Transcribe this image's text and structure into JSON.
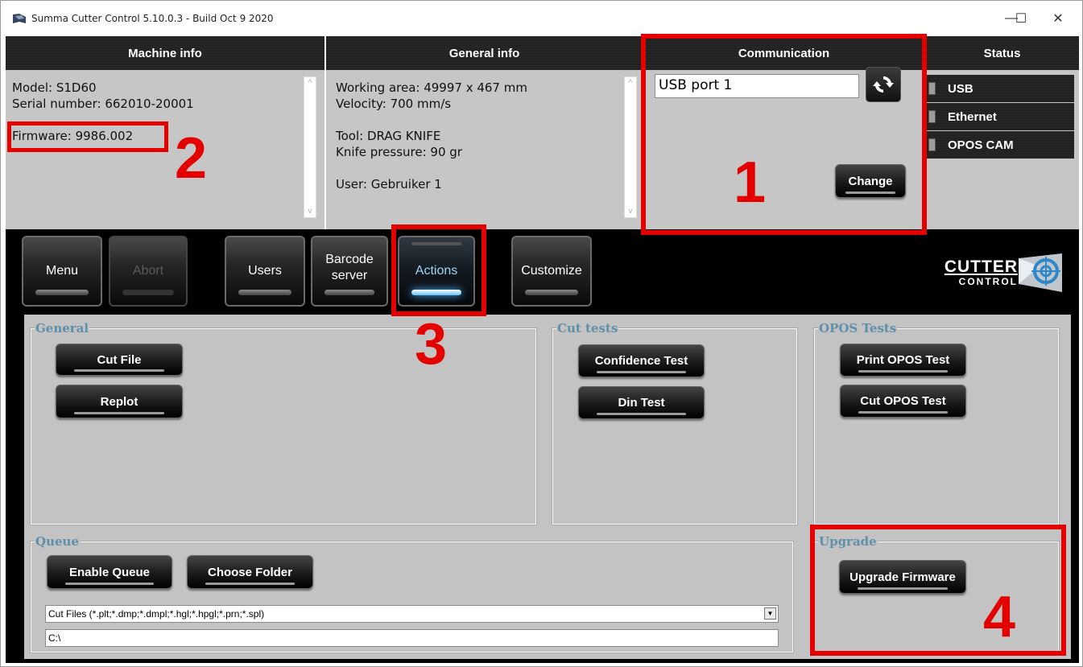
{
  "window": {
    "title": "Summa Cutter Control 5.10.0.3 - Build Oct  9 2020",
    "controls": {
      "minimize": "—",
      "maximize": "☐",
      "close": "✕"
    }
  },
  "headers": {
    "machine_info": "Machine info",
    "general_info": "General info",
    "communication": "Communication",
    "status": "Status"
  },
  "machine_info": {
    "model": "Model: S1D60",
    "serial": "Serial number: 662010-20001",
    "firmware": "Firmware: 9986.002"
  },
  "general_info": {
    "working_area": "Working area: 49997 x 467 mm",
    "velocity": "Velocity: 700 mm/s",
    "tool": "Tool: DRAG KNIFE",
    "knife_pressure": "Knife pressure: 90 gr",
    "user": "User: Gebruiker 1"
  },
  "communication": {
    "port_value": "USB port 1",
    "change_label": "Change"
  },
  "status_items": [
    "USB",
    "Ethernet",
    "OPOS CAM"
  ],
  "toolbar": {
    "menu": "Menu",
    "abort": "Abort",
    "users": "Users",
    "barcode_line1": "Barcode",
    "barcode_line2": "server",
    "actions": "Actions",
    "customize": "Customize"
  },
  "logo": {
    "line1": "CUTTER",
    "line2": "CONTROL"
  },
  "groups": {
    "general": "General",
    "cut_tests": "Cut tests",
    "opos_tests": "OPOS Tests",
    "queue": "Queue",
    "upgrade": "Upgrade"
  },
  "buttons": {
    "cut_file": "Cut File",
    "replot": "Replot",
    "confidence_test": "Confidence Test",
    "din_test": "Din Test",
    "print_opos_test": "Print OPOS Test",
    "cut_opos_test": "Cut OPOS Test",
    "enable_queue": "Enable Queue",
    "choose_folder": "Choose Folder",
    "upgrade_firmware": "Upgrade Firmware"
  },
  "queue": {
    "filter_value": "Cut Files (*.plt;*.dmp;*.dmpl;*.hgl;*.hpgl;*.prn;*.spl)",
    "path_value": "C:\\"
  },
  "annotations": {
    "n1": "1",
    "n2": "2",
    "n3": "3",
    "n4": "4"
  },
  "colors": {
    "annotation_red": "#e50000",
    "group_label": "#5f8faa",
    "panel_gray": "#c3c3c3"
  }
}
